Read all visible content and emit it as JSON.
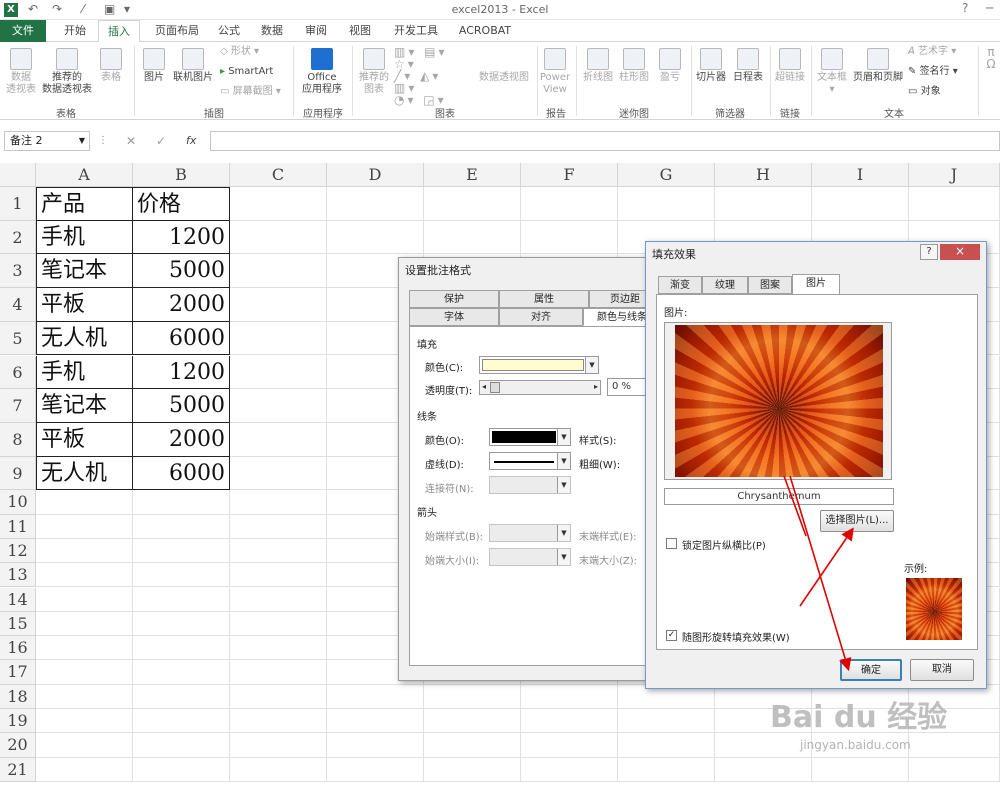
{
  "app": {
    "title": "excel2013 - Excel",
    "help": "?",
    "close_symbol": "×"
  },
  "tabs": [
    "文件",
    "开始",
    "插入",
    "页面布局",
    "公式",
    "数据",
    "审阅",
    "视图",
    "开发工具",
    "ACROBAT"
  ],
  "ribbon": {
    "buttons": [
      {
        "label": "数据\n透视表",
        "icon": "pivot-table-icon",
        "disabled": true
      },
      {
        "label": "推荐的\n数据透视表",
        "icon": "recommended-pivot-icon",
        "disabled": false
      },
      {
        "label": "表格",
        "icon": "table-icon",
        "disabled": true
      },
      {
        "label": "图片",
        "icon": "picture-icon",
        "disabled": false
      },
      {
        "label": "联机图片",
        "icon": "online-picture-icon",
        "disabled": false
      },
      {
        "label": "形状",
        "icon": "shapes-icon",
        "disabled": true
      },
      {
        "label": "SmartArt",
        "icon": "smartart-icon",
        "disabled": false
      },
      {
        "label": "屏幕截图",
        "icon": "screenshot-icon",
        "disabled": true
      },
      {
        "label": "Office\n应用程序",
        "icon": "office-app-icon",
        "disabled": false
      },
      {
        "label": "推荐的\n图表",
        "icon": "recommended-chart-icon",
        "disabled": true
      },
      {
        "label": "数据透视图",
        "icon": "pivot-chart-icon",
        "disabled": true
      },
      {
        "label": "Power\nView",
        "icon": "power-view-icon",
        "disabled": true
      },
      {
        "label": "折线图",
        "icon": "line-sparkline-icon",
        "disabled": true
      },
      {
        "label": "柱形图",
        "icon": "column-sparkline-icon",
        "disabled": true
      },
      {
        "label": "盈亏",
        "icon": "winloss-sparkline-icon",
        "disabled": true
      },
      {
        "label": "切片器",
        "icon": "slicer-icon",
        "disabled": false
      },
      {
        "label": "日程表",
        "icon": "timeline-icon",
        "disabled": false
      },
      {
        "label": "超链接",
        "icon": "hyperlink-icon",
        "disabled": true
      },
      {
        "label": "文本框",
        "icon": "textbox-icon",
        "disabled": true
      },
      {
        "label": "页眉和页脚",
        "icon": "header-footer-icon",
        "disabled": false
      },
      {
        "label": "艺术字",
        "icon": "wordart-icon",
        "disabled": true
      },
      {
        "label": "签名行",
        "icon": "signature-icon",
        "disabled": false
      },
      {
        "label": "对象",
        "icon": "object-icon",
        "disabled": false
      }
    ],
    "groups": [
      "表格",
      "插图",
      "应用程序",
      "图表",
      "报告",
      "迷你图",
      "筛选器",
      "链接",
      "文本"
    ]
  },
  "formula": {
    "name_box": "备注 2",
    "fx": "fx",
    "content": ""
  },
  "sheet": {
    "columns": [
      "A",
      "B",
      "C",
      "D",
      "E",
      "F",
      "G",
      "H",
      "I",
      "J"
    ],
    "rows": [
      [
        "产品",
        "价格"
      ],
      [
        "手机",
        "1200"
      ],
      [
        "笔记本",
        "5000"
      ],
      [
        "平板",
        "2000"
      ],
      [
        "无人机",
        "6000"
      ],
      [
        "手机",
        "1200"
      ],
      [
        "笔记本",
        "5000"
      ],
      [
        "平板",
        "2000"
      ],
      [
        "无人机",
        "6000"
      ]
    ],
    "row_numbers": [
      "1",
      "2",
      "3",
      "4",
      "5",
      "6",
      "7",
      "8",
      "9",
      "10",
      "11",
      "12",
      "13",
      "14",
      "15",
      "16",
      "17",
      "18",
      "19",
      "20",
      "21"
    ]
  },
  "comment_format_dialog": {
    "title": "设置批注格式",
    "tabs_row1": [
      "保护",
      "属性",
      "页边距"
    ],
    "tabs_row2": [
      "字体",
      "对齐",
      "颜色与线条"
    ],
    "fill_section": "填充",
    "color_label": "颜色(C):",
    "transparency_label": "透明度(T):",
    "transparency_value": "0 %",
    "line_section": "线条",
    "line_color_label": "颜色(O):",
    "dash_label": "虚线(D):",
    "connector_label": "连接符(N):",
    "style_label": "样式(S):",
    "weight_label": "粗细(W):",
    "arrow_section": "箭头",
    "begin_style_label": "始端样式(B):",
    "end_style_label": "末端样式(E):",
    "begin_size_label": "始端大小(I):",
    "end_size_label": "末端大小(Z):",
    "fill_color": "#fffdd0"
  },
  "fill_effects_dialog": {
    "title": "填充效果",
    "help": "?",
    "close": "×",
    "tabs": [
      "渐变",
      "纹理",
      "图案",
      "图片"
    ],
    "picture_label": "图片:",
    "picture_name": "Chrysanthemum",
    "select_picture_button": "选择图片(L)...",
    "lock_aspect_label": "锁定图片纵横比(P)",
    "sample_label": "示例:",
    "rotate_label": "随图形旋转填充效果(W)",
    "ok_button": "确定",
    "cancel_button": "取消",
    "lock_aspect_checked": false,
    "rotate_checked": true
  },
  "watermark": {
    "text": "Bai du 经验",
    "url": "jingyan.baidu.com"
  }
}
